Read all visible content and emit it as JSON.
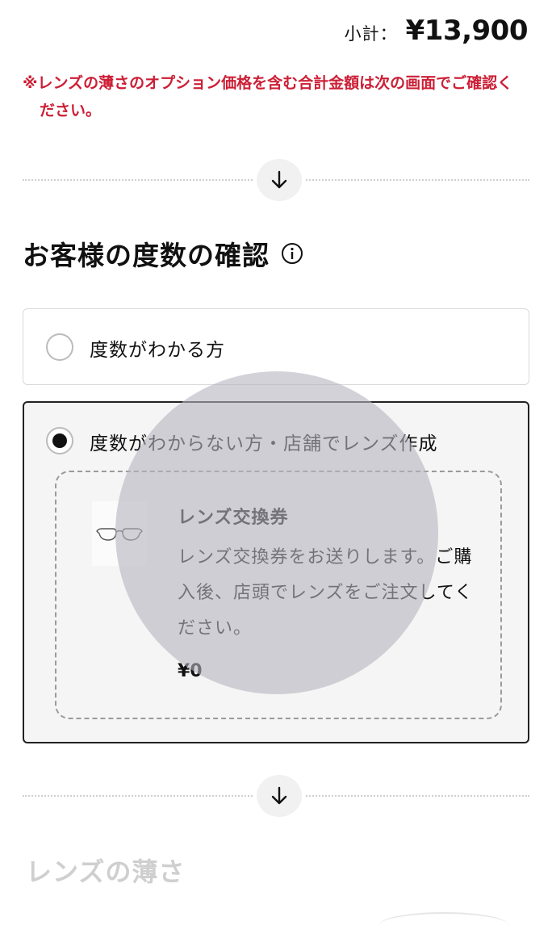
{
  "header": {
    "subtotal_label": "小計：",
    "subtotal_value": "¥13,900"
  },
  "notice": {
    "text": "※レンズの薄さのオプション価格を含む合計金額は次の画面でご確認ください。",
    "color": "#cc1f36"
  },
  "divider": {
    "icon": "arrow-down-icon"
  },
  "prescription": {
    "title": "お客様の度数の確認",
    "info_icon": "info-icon",
    "options": [
      {
        "label": "度数がわかる方",
        "selected": false
      },
      {
        "label": "度数がわからない方・店舗でレンズ作成",
        "selected": true,
        "ticket": {
          "icon": "glasses-icon",
          "title": "レンズ交換券",
          "description": "レンズ交換券をお送りします。ご購入後、店頭でレンズをご注文してください。",
          "price": "¥0"
        }
      }
    ]
  },
  "next_section": {
    "title": "レンズの薄さ"
  }
}
